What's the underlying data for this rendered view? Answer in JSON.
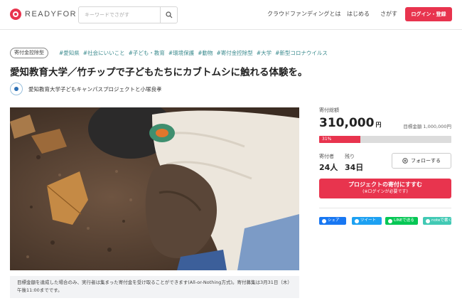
{
  "header": {
    "logo_text": "READYFOR",
    "search_placeholder": "キーワードでさがす",
    "nav": [
      "クラウドファンディングとは",
      "はじめる",
      "さがす"
    ],
    "login_label": "ログイン・登録"
  },
  "project": {
    "type_tag": "寄付金控除型",
    "tags": [
      "#愛知県",
      "#社会にいいこと",
      "#子ども・教育",
      "#環境保護",
      "#動物",
      "#寄付金控除型",
      "#大学",
      "#新型コロナウイルス"
    ],
    "title": "愛知教育大学／竹チップで子どもたちにカブトムシに触れる体験を。",
    "owner": "愛知教育大学子どもキャンパスプロジェクトと小塚良孝",
    "notice": "目標金額を達成した場合のみ、実行者は集まった寄付金を受け取ることができます(All-or-Nothing方式)。寄付募集は3月31日（木）午後11:00までです。"
  },
  "funding": {
    "total_label": "寄付総額",
    "total_amount": "310,000",
    "currency": "円",
    "goal_text": "目標金額 1,000,000円",
    "progress_percent": 31,
    "progress_label": "31%",
    "donors_label": "寄付者",
    "donors_value": "24人",
    "remaining_label": "残り",
    "remaining_value": "34日",
    "follow_label": "フォローする",
    "donate_label": "プロジェクトの寄付にすすむ",
    "donate_sub": "(※ログインが必要です)"
  },
  "share": {
    "facebook": "シェア",
    "twitter": "ツイート",
    "line": "LINEで送る",
    "note": "noteで書く"
  },
  "colors": {
    "brand": "#e8344e",
    "tag": "#3a8a8d",
    "facebook": "#1877f2",
    "twitter": "#1da1f2",
    "line": "#06c755",
    "note": "#41c9b4"
  }
}
